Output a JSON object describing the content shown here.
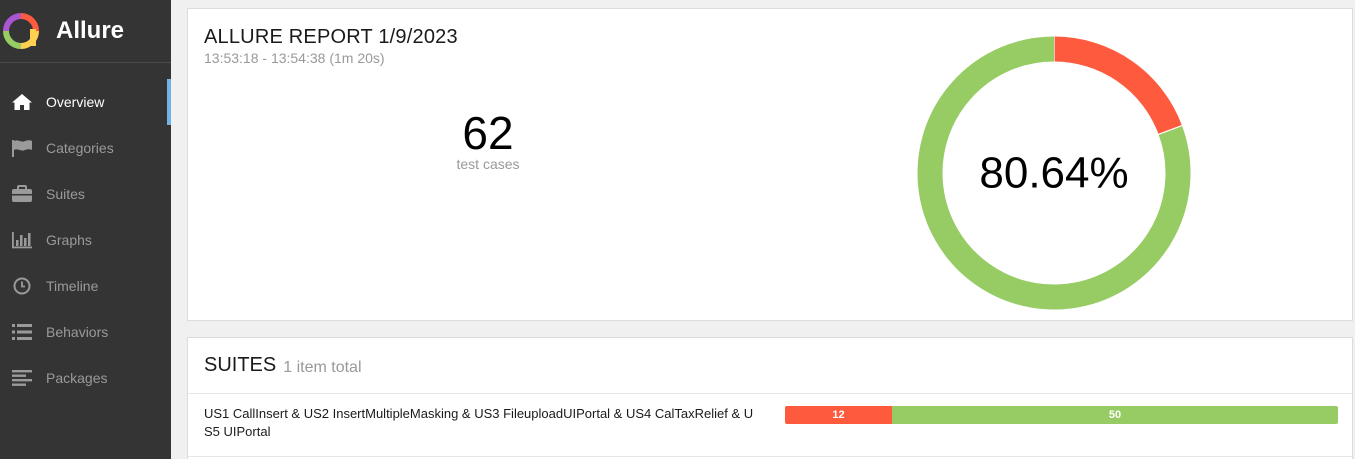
{
  "app": {
    "name": "Allure",
    "logo_colors": [
      "#fd5a3e",
      "#ffd050",
      "#97cc64",
      "#6fb3e8",
      "#aa56d1"
    ]
  },
  "sidebar": {
    "items": [
      {
        "label": "Overview",
        "icon": "home-icon",
        "active": true
      },
      {
        "label": "Categories",
        "icon": "flag-icon",
        "active": false
      },
      {
        "label": "Suites",
        "icon": "briefcase-icon",
        "active": false
      },
      {
        "label": "Graphs",
        "icon": "bar-chart-icon",
        "active": false
      },
      {
        "label": "Timeline",
        "icon": "clock-icon",
        "active": false
      },
      {
        "label": "Behaviors",
        "icon": "list-icon",
        "active": false
      },
      {
        "label": "Packages",
        "icon": "align-left-icon",
        "active": false
      }
    ]
  },
  "summary": {
    "title": "ALLURE REPORT 1/9/2023",
    "time_range": "13:53:18 - 13:54:38 (1m 20s)",
    "count": "62",
    "count_label": "test cases",
    "percent": "80.64%"
  },
  "chart_data": {
    "type": "pie",
    "style": "donut",
    "labels": [
      "failed",
      "passed"
    ],
    "values": [
      12,
      50
    ],
    "colors": [
      "#fd5a3e",
      "#97cc64"
    ],
    "center_text": "80.64%"
  },
  "suites": {
    "title": "SUITES",
    "count_text": "1 item total",
    "rows": [
      {
        "name": "US1 CallInsert & US2 InsertMultipleMasking & US3 FileuploadUIPortal & US4 CalTaxRelief & US5 UIPortal",
        "failed": 12,
        "passed": 50,
        "failed_label": "12",
        "passed_label": "50"
      }
    ]
  },
  "colors": {
    "sidebar_bg": "#343434",
    "active_marker": "#6fb3e8",
    "failed": "#fd5a3e",
    "passed": "#97cc64"
  }
}
